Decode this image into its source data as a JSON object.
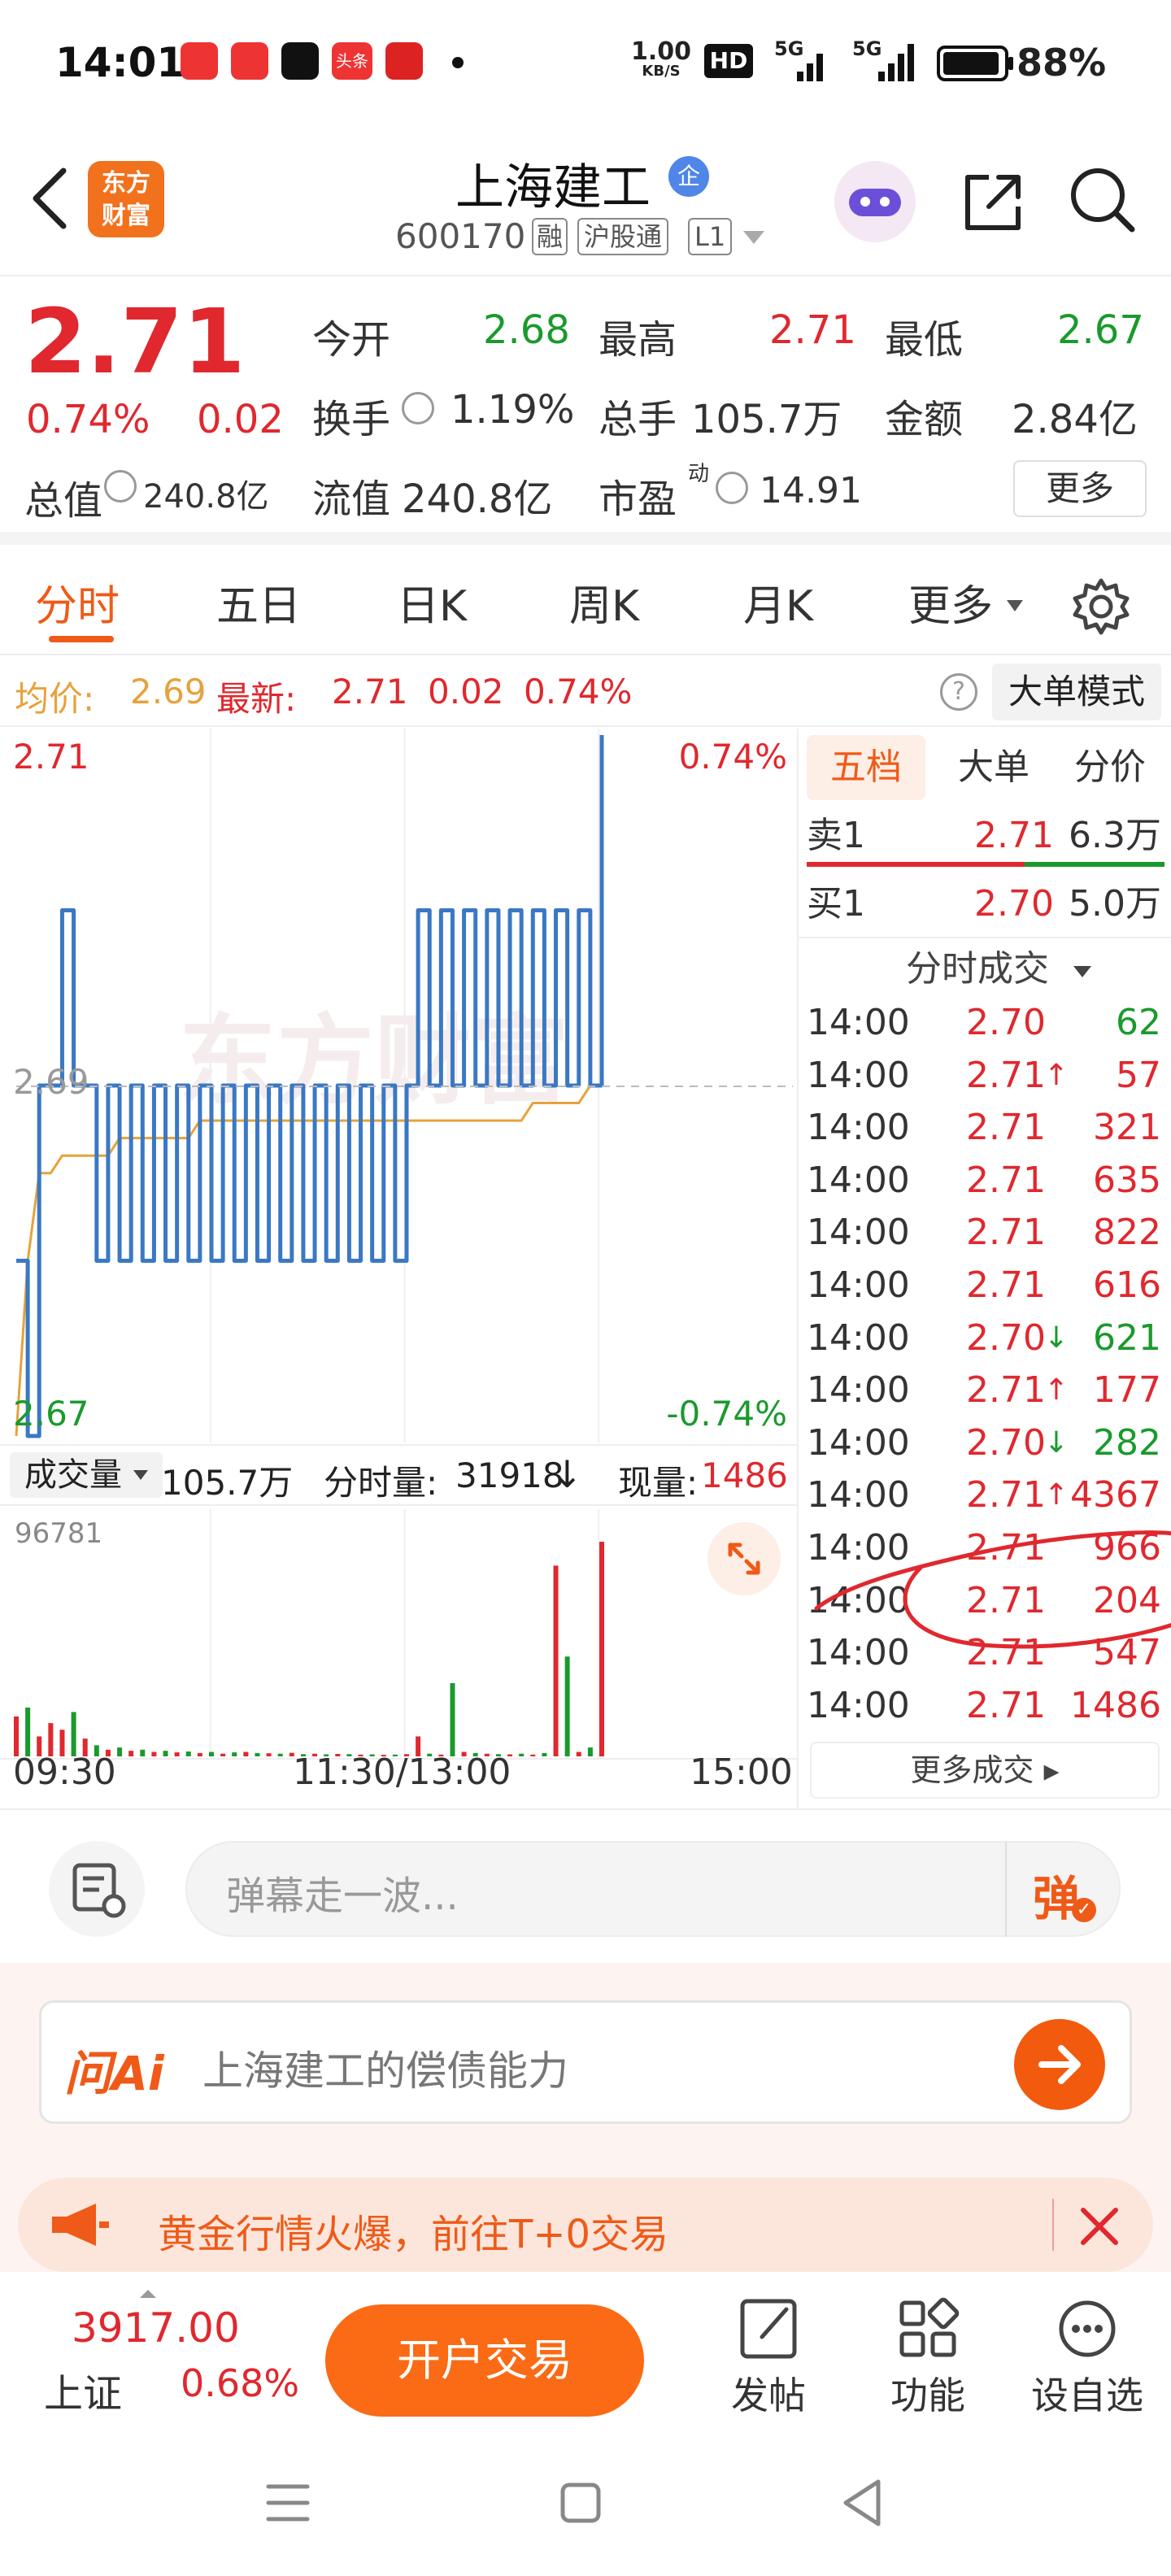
{
  "status_bar": {
    "time": "14:01",
    "net_speed_value": "1.00",
    "net_speed_unit": "KB/S",
    "hd": "HD",
    "signal1": "5G",
    "signal2": "5G",
    "battery": "88%",
    "app_icon_labels": [
      "头条"
    ]
  },
  "header": {
    "title": "上海建工",
    "enterprise_badge": "企",
    "code": "600170",
    "tag_margin": "融",
    "tag_connect": "沪股通",
    "tag_level": "L1",
    "logo_line1": "东方",
    "logo_line2": "财富"
  },
  "quote": {
    "price": "2.71",
    "change_pct": "0.74%",
    "change": "0.02",
    "open_label": "今开",
    "open": "2.68",
    "high_label": "最高",
    "high": "2.71",
    "low_label": "最低",
    "low": "2.67",
    "turnover_label": "换手",
    "turnover": "1.19%",
    "volume_label": "总手",
    "volume": "105.7万",
    "amount_label": "金额",
    "amount": "2.84亿",
    "total_cap_label": "总值",
    "total_cap": "240.8亿",
    "float_cap_label": "流值",
    "float_cap": "240.8亿",
    "pe_label": "市盈",
    "pe_sup": "动",
    "pe": "14.91",
    "more_button": "更多"
  },
  "tabs": [
    "分时",
    "五日",
    "日K",
    "周K",
    "月K",
    "更多"
  ],
  "avg_bar": {
    "avg_label": "均价:",
    "avg_value": "2.69",
    "latest_label": "最新:",
    "latest_price": "2.71",
    "latest_change": "0.02",
    "latest_pct": "0.74%",
    "big_order_button": "大单模式"
  },
  "chart": {
    "price_top": "2.71",
    "price_mid": "2.69",
    "price_bottom": "2.67",
    "pct_top": "0.74%",
    "pct_bottom": "-0.74%",
    "watermark": "东方财富",
    "volume_dropdown": "成交量",
    "volume_total": "105.7万",
    "minute_volume_label": "分时量:",
    "minute_volume": "31918",
    "current_volume_label": "现量:",
    "current_volume": "1486",
    "vol_axis_max": "96781",
    "time_start": "09:30",
    "time_mid": "11:30/13:00",
    "time_end": "15:00"
  },
  "chart_data": {
    "type": "line",
    "ylim": [
      2.67,
      2.71
    ],
    "xlim": [
      "09:30",
      "15:00"
    ],
    "series": [
      {
        "name": "最新",
        "values": [
          2.68,
          2.67,
          2.69,
          2.69,
          2.7,
          2.69,
          2.69,
          2.68,
          2.69,
          2.68,
          2.69,
          2.68,
          2.69,
          2.68,
          2.69,
          2.68,
          2.69,
          2.68,
          2.69,
          2.68,
          2.69,
          2.68,
          2.69,
          2.68,
          2.69,
          2.68,
          2.69,
          2.68,
          2.69,
          2.68,
          2.69,
          2.68,
          2.69,
          2.68,
          2.69,
          2.7,
          2.69,
          2.7,
          2.69,
          2.7,
          2.69,
          2.7,
          2.69,
          2.7,
          2.69,
          2.7,
          2.69,
          2.7,
          2.69,
          2.7,
          2.69,
          2.71
        ]
      },
      {
        "name": "均价",
        "values": [
          2.67,
          2.68,
          2.685,
          2.685,
          2.686,
          2.686,
          2.686,
          2.686,
          2.686,
          2.687,
          2.687,
          2.687,
          2.687,
          2.687,
          2.687,
          2.687,
          2.688,
          2.688,
          2.688,
          2.688,
          2.688,
          2.688,
          2.688,
          2.688,
          2.688,
          2.688,
          2.688,
          2.688,
          2.688,
          2.688,
          2.688,
          2.688,
          2.688,
          2.688,
          2.688,
          2.688,
          2.688,
          2.688,
          2.688,
          2.688,
          2.688,
          2.688,
          2.688,
          2.688,
          2.688,
          2.689,
          2.689,
          2.689,
          2.689,
          2.689,
          2.69,
          2.69
        ]
      }
    ],
    "volume": {
      "ylim": [
        0,
        96781
      ],
      "values": [
        18000,
        22000,
        9000,
        15000,
        12000,
        20000,
        8000,
        5000,
        3000,
        4000,
        2500,
        3000,
        2000,
        2500,
        1800,
        2200,
        1500,
        2000,
        1200,
        1800,
        2000,
        1500,
        1400,
        1200,
        1600,
        1000,
        1200,
        900,
        1100,
        1000,
        800,
        900,
        700,
        800,
        1000,
        9000,
        1200,
        800,
        33000,
        2000,
        1500,
        1200,
        1000,
        900,
        1200,
        800,
        1500,
        86000,
        45000,
        2000,
        4000,
        96781
      ]
    }
  },
  "orderbook": {
    "tabs": [
      "五档",
      "大单",
      "分价"
    ],
    "sell1_label": "卖1",
    "sell1_price": "2.71",
    "sell1_vol": "6.3万",
    "buy1_label": "买1",
    "buy1_price": "2.70",
    "buy1_vol": "5.0万",
    "ticks_header": "分时成交",
    "ticks": [
      {
        "time": "14:00",
        "price": "2.70",
        "arrow": "",
        "vol": "62",
        "color": "#e0282e",
        "vcolor": "#1a9a2c"
      },
      {
        "time": "14:00",
        "price": "2.71",
        "arrow": "↑",
        "vol": "57",
        "color": "#e0282e",
        "vcolor": "#e0282e"
      },
      {
        "time": "14:00",
        "price": "2.71",
        "arrow": "",
        "vol": "321",
        "color": "#e0282e",
        "vcolor": "#e0282e"
      },
      {
        "time": "14:00",
        "price": "2.71",
        "arrow": "",
        "vol": "635",
        "color": "#e0282e",
        "vcolor": "#e0282e"
      },
      {
        "time": "14:00",
        "price": "2.71",
        "arrow": "",
        "vol": "822",
        "color": "#e0282e",
        "vcolor": "#e0282e"
      },
      {
        "time": "14:00",
        "price": "2.71",
        "arrow": "",
        "vol": "616",
        "color": "#e0282e",
        "vcolor": "#e0282e"
      },
      {
        "time": "14:00",
        "price": "2.70",
        "arrow": "↓",
        "vol": "621",
        "color": "#e0282e",
        "vcolor": "#1a9a2c"
      },
      {
        "time": "14:00",
        "price": "2.71",
        "arrow": "↑",
        "vol": "177",
        "color": "#e0282e",
        "vcolor": "#e0282e"
      },
      {
        "time": "14:00",
        "price": "2.70",
        "arrow": "↓",
        "vol": "282",
        "color": "#e0282e",
        "vcolor": "#1a9a2c"
      },
      {
        "time": "14:00",
        "price": "2.71",
        "arrow": "↑",
        "vol": "4367",
        "color": "#e0282e",
        "vcolor": "#e0282e"
      },
      {
        "time": "14:00",
        "price": "2.71",
        "arrow": "",
        "vol": "966",
        "color": "#e0282e",
        "vcolor": "#e0282e"
      },
      {
        "time": "14:00",
        "price": "2.71",
        "arrow": "",
        "vol": "204",
        "color": "#e0282e",
        "vcolor": "#e0282e"
      },
      {
        "time": "14:00",
        "price": "2.71",
        "arrow": "",
        "vol": "547",
        "color": "#e0282e",
        "vcolor": "#e0282e"
      },
      {
        "time": "14:00",
        "price": "2.71",
        "arrow": "",
        "vol": "1486",
        "color": "#e0282e",
        "vcolor": "#e0282e"
      }
    ],
    "more_trades": "更多成交"
  },
  "danmu": {
    "placeholder": "弹幕走一波...",
    "send_label": "弹"
  },
  "ai": {
    "logo": "问Ai",
    "query": "上海建工的偿债能力"
  },
  "promo": {
    "text": "黄金行情火爆，前往T+0交易"
  },
  "bottom": {
    "index_value": "3917.00",
    "index_name": "上证",
    "index_pct": "0.68%",
    "trade_button": "开户交易",
    "post_label": "发帖",
    "function_label": "功能",
    "watchlist_label": "设自选"
  },
  "colors": {
    "up": "#e0282e",
    "down": "#1a9a2c",
    "accent": "#ef5a18",
    "line": "#3a78c4",
    "avg": "#e6a23c"
  }
}
